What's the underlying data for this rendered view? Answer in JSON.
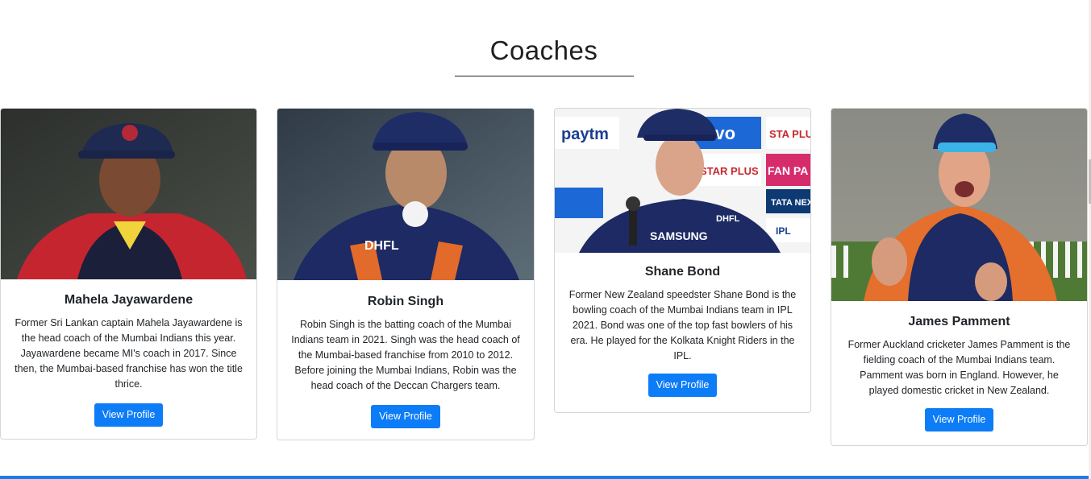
{
  "section": {
    "title": "Coaches"
  },
  "coaches": [
    {
      "name": "Mahela Jayawardene",
      "description": "Former Sri Lankan captain Mahela Jayawardene is the head coach of the Mumbai Indians this year. Jayawardene became MI's coach in 2017. Since then, the Mumbai-based franchise has won the title thrice.",
      "button_label": "View Profile"
    },
    {
      "name": "Robin Singh",
      "description": "Robin Singh is the batting coach of the Mumbai Indians team in 2021. Singh was the head coach of the Mumbai-based franchise from 2010 to 2012. Before joining the Mumbai Indians, Robin was the head coach of the Deccan Chargers team.",
      "button_label": "View Profile"
    },
    {
      "name": "Shane Bond",
      "description": "Former New Zealand speedster Shane Bond is the bowling coach of the Mumbai Indians team in IPL 2021. Bond was one of the top fast bowlers of his era. He played for the Kolkata Knight Riders in the IPL.",
      "button_label": "View Profile",
      "photo_text": {
        "a": "paytm",
        "b": "vivo",
        "c": "STAR PLUS",
        "d": "FAN PA",
        "e": "TATA NEXO",
        "f": "IPL",
        "g": "SAMSUNG",
        "h": "DHFL"
      }
    },
    {
      "name": "James Pamment",
      "description": "Former Auckland cricketer James Pamment is the fielding coach of the Mumbai Indians team. Pamment was born in England. However, he played domestic cricket in New Zealand.",
      "button_label": "View Profile"
    }
  ],
  "colors": {
    "button": "#0d7cf7",
    "accent_bar": "#1a7ce6",
    "team_blue": "#1b2a5e"
  }
}
